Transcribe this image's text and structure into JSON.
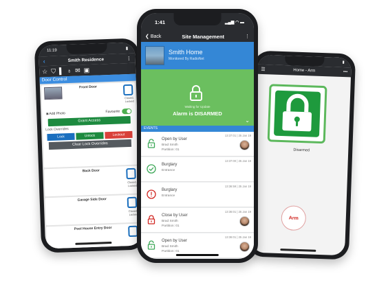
{
  "left_phone": {
    "status_time": "11:19",
    "title": "Smith Residence",
    "section": "Door Control",
    "doors": [
      {
        "name": "Front Door",
        "status_line1": "Closed,",
        "status_line2": "Locked"
      },
      {
        "name": "Back Door",
        "status_line1": "Closed,",
        "status_line2": "Locked"
      },
      {
        "name": "Garage Side Door",
        "status_line1": "Closed,",
        "status_line2": "Locked"
      },
      {
        "name": "Pool House Entry Door",
        "status_line1": "",
        "status_line2": ""
      }
    ],
    "add_photo": "Add Photo",
    "favourite": "Favourite",
    "grant_access": "Grant Access",
    "lock_overrides": "Lock Overrides",
    "lock": "Lock",
    "unlock": "Unlock",
    "lockout": "Lockout",
    "clear_overrides": "Clear Lock Overrides",
    "colors": {
      "lock": "#1a6fbf",
      "unlock": "#1d8a3f",
      "lockout": "#d9413a"
    }
  },
  "center_phone": {
    "status_time": "1:41",
    "back": "Back",
    "title": "Site Management",
    "site_name": "Smith Home",
    "site_sub": "Monitored By RadioNet",
    "waiting": "Waiting for Update",
    "arm_state": "Alarm is DISARMED",
    "events_header": "EVENTS",
    "events": [
      {
        "icon": "unlock-icon",
        "color": "#3aa655",
        "title": "Open by User",
        "line1": "Brad Smith",
        "line2": "Partition: 01",
        "time": "13:37:01 | 25 Jan 19",
        "avatar": true
      },
      {
        "icon": "check-circle-icon",
        "color": "#3aa655",
        "title": "Burglary",
        "line1": "Entrance",
        "line2": "",
        "time": "13:37:00 | 25 Jan 19",
        "avatar": false
      },
      {
        "icon": "alert-circle-icon",
        "color": "#d0231e",
        "title": "Burglary",
        "line1": "Entrance",
        "line2": "",
        "time": "13:36:59 | 25 Jan 19",
        "avatar": false
      },
      {
        "icon": "lock-icon",
        "color": "#d0231e",
        "title": "Close by User",
        "line1": "Brad Smith",
        "line2": "Partition: 01",
        "time": "13:36:01 | 25 Jan 19",
        "avatar": true
      },
      {
        "icon": "unlock-icon",
        "color": "#3aa655",
        "title": "Open by User",
        "line1": "Brad Smith",
        "line2": "Partition: 01",
        "time": "13:36:01 | 25 Jan 19",
        "avatar": true
      }
    ]
  },
  "right_phone": {
    "title": "Home - Arm",
    "state": "Disarmed",
    "arm": "Arm"
  }
}
